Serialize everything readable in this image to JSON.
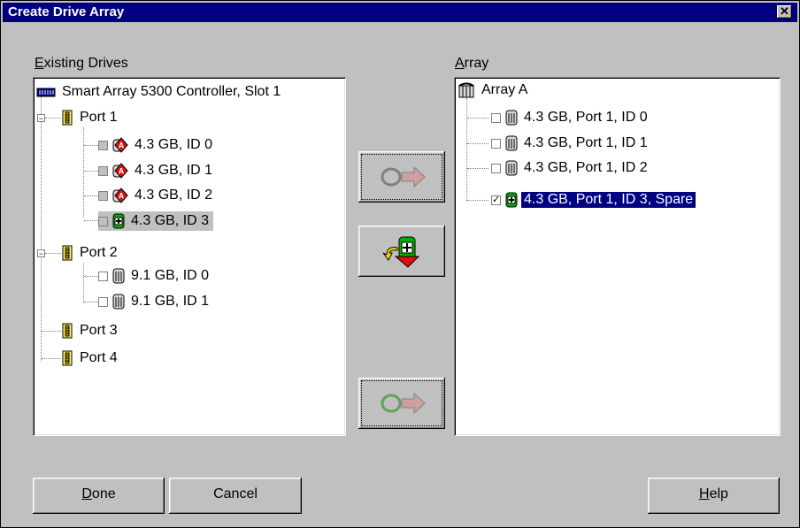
{
  "window": {
    "title": "Create Drive Array",
    "close_symbol": "✕"
  },
  "left": {
    "label_prefix": "E",
    "label_rest": "xisting Drives",
    "controller": "Smart Array 5300 Controller, Slot 1",
    "port1": "Port 1",
    "p1d0": "4.3 GB, ID 0",
    "p1d1": "4.3 GB, ID 1",
    "p1d2": "4.3 GB, ID 2",
    "p1d3": "4.3 GB, ID 3",
    "port2": "Port 2",
    "p2d0": "9.1 GB, ID 0",
    "p2d1": "9.1 GB, ID 1",
    "port3": "Port 3",
    "port4": "Port 4"
  },
  "right": {
    "label_prefix": "A",
    "label_rest": "rray",
    "array": "Array A",
    "d0": "4.3 GB, Port 1, ID 0",
    "d1": "4.3 GB, Port 1, ID 1",
    "d2": "4.3 GB, Port 1, ID 2",
    "d3": "4.3 GB, Port 1, ID 3, Spare"
  },
  "buttons": {
    "done_prefix": "D",
    "done_rest": "one",
    "cancel": "Cancel",
    "help_prefix": "H",
    "help_rest": "elp"
  },
  "colors": {
    "titlebar": "#000080",
    "face": "#c0c0c0",
    "selection": "#000080",
    "spare_green": "#009900",
    "failed_red": "#e01010"
  }
}
